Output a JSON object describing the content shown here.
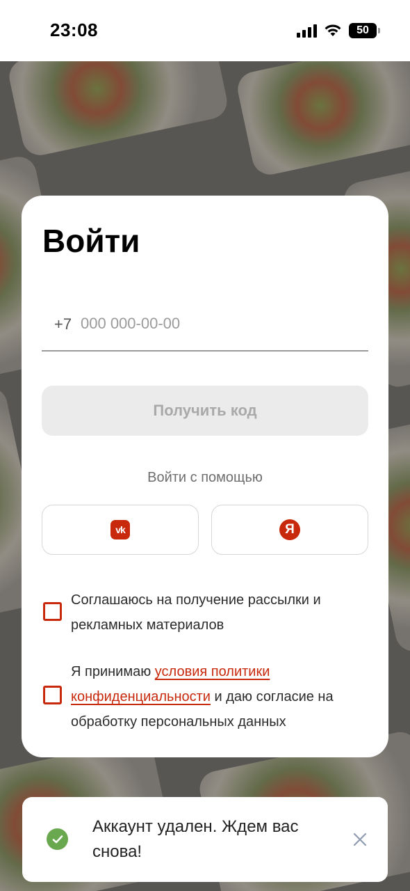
{
  "status_bar": {
    "time": "23:08",
    "battery": "50",
    "icons": [
      "signal-icon",
      "wifi-icon",
      "battery-icon"
    ]
  },
  "login": {
    "title": "Войти",
    "phone": {
      "prefix": "+7",
      "placeholder": "000 000-00-00",
      "value": ""
    },
    "get_code_label": "Получить код",
    "login_with_label": "Войти с помощью",
    "social": [
      {
        "name": "vk",
        "icon": "vk-icon",
        "glyph": "vk"
      },
      {
        "name": "yandex",
        "icon": "yandex-icon",
        "glyph": "Я"
      }
    ],
    "consent_marketing": {
      "checked": false,
      "text": "Соглашаюсь на получение рассылки и рекламных материалов"
    },
    "consent_privacy": {
      "checked": false,
      "text_before": "Я принимаю ",
      "link_text": "условия политики конфиденциальности",
      "text_after": " и даю согласие на обработку персональных данных"
    }
  },
  "toast": {
    "message": "Аккаунт удален. Ждем вас снова!",
    "icon": "check-circle-icon",
    "close_icon": "close-icon"
  },
  "colors": {
    "accent": "#c8290c",
    "success": "#6aa84f",
    "disabled_button_bg": "#ebebeb",
    "disabled_button_text": "#a9a9a9"
  }
}
